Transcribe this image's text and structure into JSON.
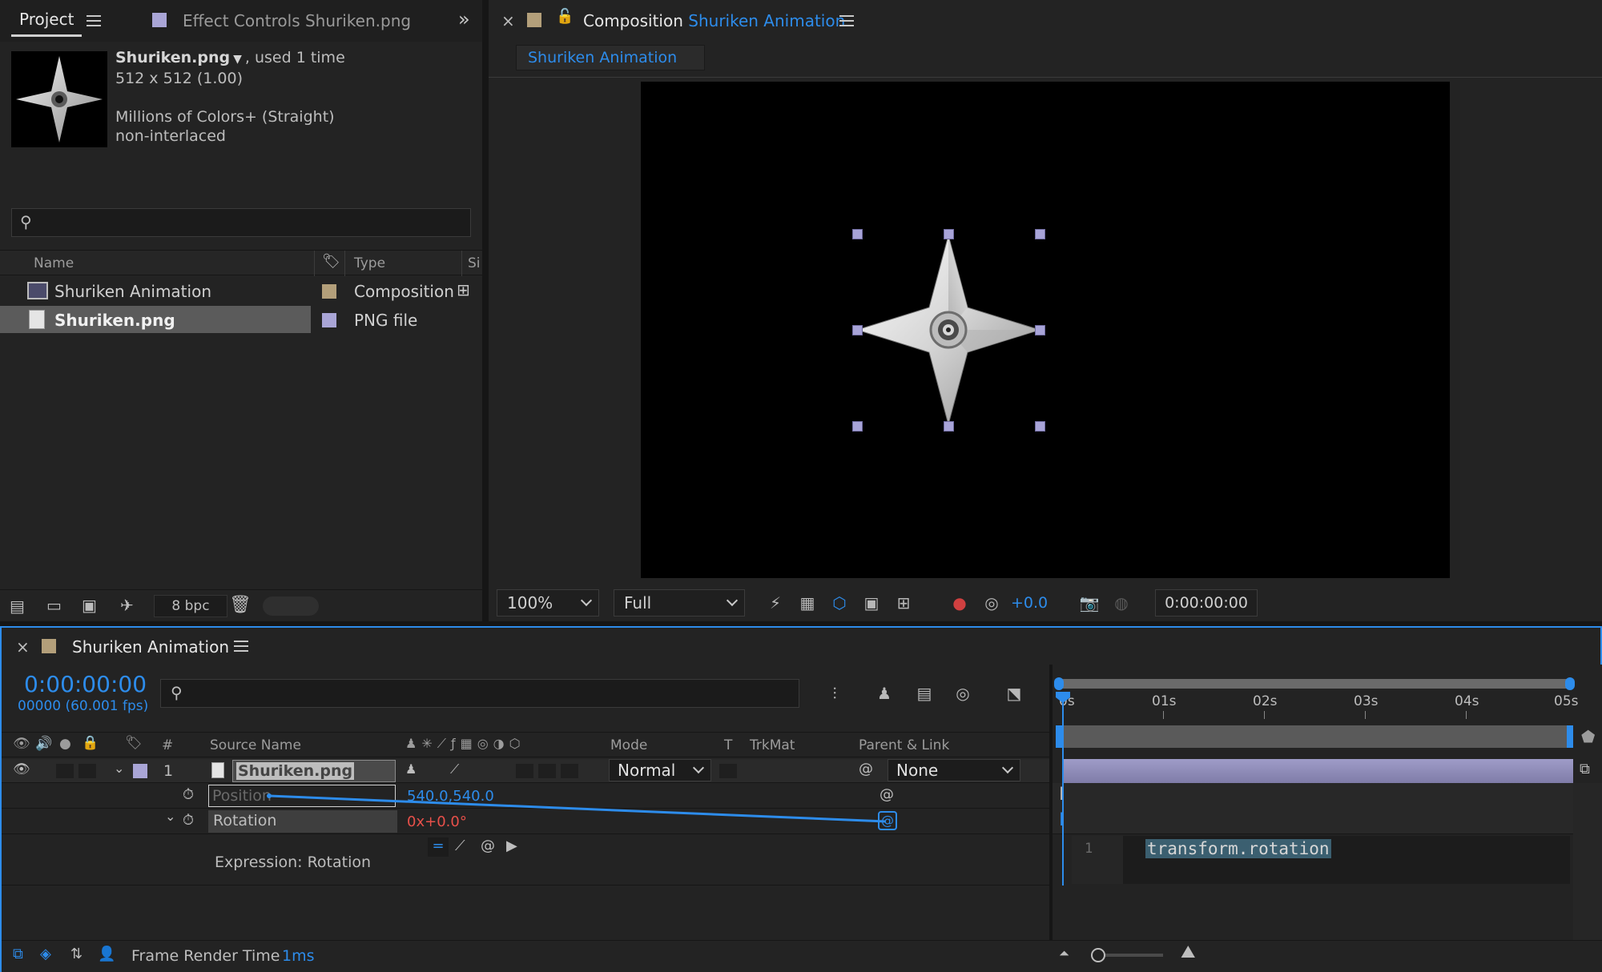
{
  "project_panel": {
    "tab_project": "Project",
    "tab_effect_controls": "Effect Controls Shuriken.png",
    "asset_name": "Shuriken.png",
    "asset_used": ", used 1 time",
    "asset_dims": "512 x 512 (1.00)",
    "asset_colors": "Millions of Colors+ (Straight)",
    "asset_interlace": "non-interlaced",
    "search_placeholder": "",
    "columns": {
      "name": "Name",
      "type": "Type",
      "size": "Si"
    },
    "items": [
      {
        "name": "Shuriken Animation",
        "type": "Composition",
        "label_color": "#b39f7a",
        "selected": false
      },
      {
        "name": "Shuriken.png",
        "type": "PNG file",
        "label_color": "#a9a5d6",
        "selected": true
      }
    ],
    "bpc": "8 bpc"
  },
  "composition_panel": {
    "tab_prefix": "Composition",
    "tab_name": "Shuriken Animation",
    "breadcrumb": "Shuriken Animation",
    "zoom": "100%",
    "resolution": "Full",
    "exposure": "+0.0",
    "timecode": "0:00:00:00"
  },
  "timeline_panel": {
    "tab_name": "Shuriken Animation",
    "current_time": "0:00:00:00",
    "frame_info": "00000 (60.001 fps)",
    "search_placeholder": "",
    "ruler": [
      "0s",
      "01s",
      "02s",
      "03s",
      "04s",
      "05s"
    ],
    "headers": {
      "num": "#",
      "source_name": "Source Name",
      "mode": "Mode",
      "t": "T",
      "trkmat": "TrkMat",
      "parent": "Parent & Link"
    },
    "layer": {
      "index": "1",
      "name": "Shuriken.png",
      "mode": "Normal",
      "parent": "None"
    },
    "properties": [
      {
        "name": "Position",
        "value": "540.0,540.0"
      },
      {
        "name": "Rotation",
        "value_revs": "0x",
        "value_deg": "+0.0°"
      }
    ],
    "expression_label": "Expression: Rotation",
    "expression_line_number": "1",
    "expression_code": "transform.rotation",
    "status_label": "Frame Render Time",
    "status_value": "1ms"
  },
  "colors": {
    "accent": "#2d8ceb",
    "comp_label": "#b39f7a",
    "png_label": "#a9a5d6",
    "red_value": "#e8504a"
  }
}
